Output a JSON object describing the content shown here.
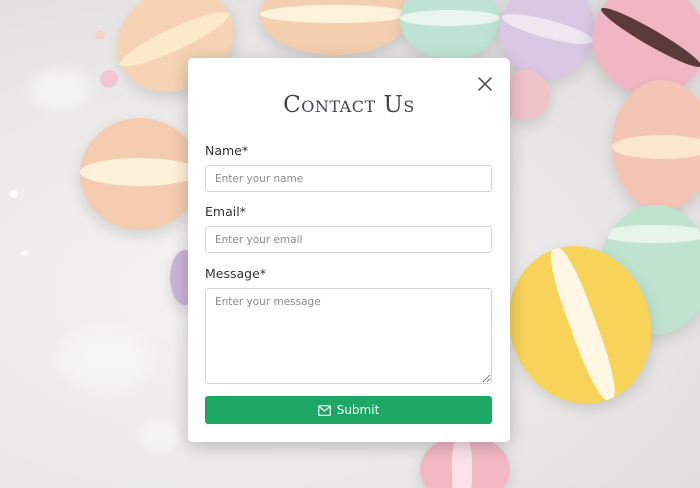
{
  "modal": {
    "title": "Contact Us",
    "close_icon": "close-icon"
  },
  "form": {
    "name": {
      "label": "Name*",
      "placeholder": "Enter your name"
    },
    "email": {
      "label": "Email*",
      "placeholder": "Enter your email"
    },
    "message": {
      "label": "Message*",
      "placeholder": "Enter your message"
    },
    "submit": {
      "label": "Submit",
      "icon": "envelope-icon"
    }
  },
  "colors": {
    "accent": "#1ba764",
    "title": "#44424a",
    "background": "#ecebea"
  }
}
